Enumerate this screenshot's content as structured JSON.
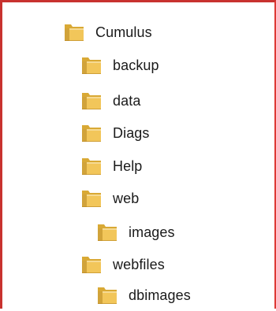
{
  "window": {
    "border_color": "#c8322f"
  },
  "folder_icon": {
    "name": "folder-icon",
    "color_front": "#f2c65a",
    "color_back": "#d9a935",
    "color_dark": "#b78620"
  },
  "tree": {
    "items": [
      {
        "label": "Cumulus",
        "name": "tree-item-cumulus",
        "depth": 0
      },
      {
        "label": "backup",
        "name": "tree-item-backup",
        "depth": 1
      },
      {
        "label": "data",
        "name": "tree-item-data",
        "depth": 1
      },
      {
        "label": "Diags",
        "name": "tree-item-diags",
        "depth": 1
      },
      {
        "label": "Help",
        "name": "tree-item-help",
        "depth": 1
      },
      {
        "label": "web",
        "name": "tree-item-web",
        "depth": 1
      },
      {
        "label": "images",
        "name": "tree-item-images",
        "depth": 2
      },
      {
        "label": "webfiles",
        "name": "tree-item-webfiles",
        "depth": 1
      },
      {
        "label": "dbimages",
        "name": "tree-item-dbimages",
        "depth": 2
      }
    ]
  }
}
